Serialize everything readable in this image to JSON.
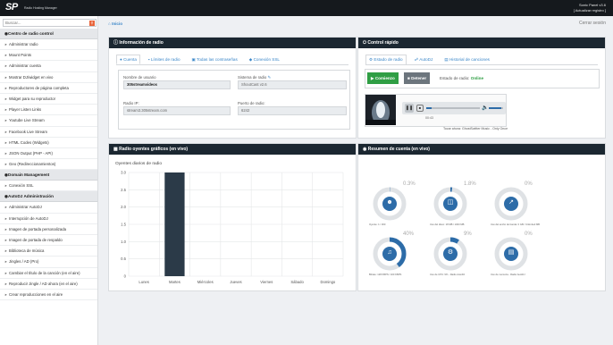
{
  "topbar": {
    "logo": "SP",
    "logo_sub": "Radio Hosting Manager",
    "right_line1": "Sonic Panel v3.6",
    "right_line2": "[ Actualizar registro ]"
  },
  "sidebar": {
    "search_placeholder": "Buscar...",
    "sections": [
      {
        "title": "Centro de radio control",
        "items": [
          "Administrar radio",
          "Mount Points",
          "Administrar cuenta",
          "Mostrar DJ/widget en vivo",
          "Reproductores de página completa",
          "Widget para su reproductor",
          "Player Listen Links",
          "Youtube Live Stream",
          "Facebook Live Stream",
          "HTML Codes (Widgets)",
          "JSON Output (PHP - API)",
          "Geo (Redireccionamientos)"
        ]
      },
      {
        "title": "Domain Management",
        "items": [
          "Conexión SSL"
        ]
      },
      {
        "title": "AutoDJ Administración",
        "items": [
          "Administrar AutoDJ",
          "Interrupción de AutoDJ",
          "Imagen de portada personalizada",
          "Imagen de portada de respaldo",
          "Biblioteca de música",
          "Jingles / AD (Pro)",
          "Cambiar el título de la canción (en el aire)",
          "Reproducir Jingle / AD ahora (en el aire)",
          "Crear reproducciones en el aire"
        ]
      }
    ]
  },
  "main": {
    "breadcrumb": "Inicio",
    "logout": "Cerrar sesión"
  },
  "radio_info": {
    "title": "Información de radio",
    "tabs": [
      "Cuenta",
      "Límites de radio",
      "Todas las contraseñas",
      "Conexión SSL"
    ],
    "fields": [
      {
        "label": "Nombre de usuario",
        "value": "305streamvideos"
      },
      {
        "label": "Sistema de radio",
        "value": "ShoutCast v2.6"
      },
      {
        "label": "Radio IP:",
        "value": "stream3.305stream.com"
      },
      {
        "label": "Puerto de radio:",
        "value": "6242"
      }
    ]
  },
  "quick_control": {
    "title": "Control rápido",
    "tabs": [
      "Estado de radio",
      "AutoDJ",
      "Historial de canciones"
    ],
    "start_label": "Comienzo",
    "stop_label": "Detener",
    "status_label": "Estado de radio:",
    "status_value": "Online",
    "time": "00:43",
    "now_playing": "Tocar ahora: GhostSwitter Music - Only Once",
    "progress": 0.1,
    "volume": 0.85
  },
  "listeners_chart": {
    "title": "Radio oyentes gráficos (en vivo)",
    "subtitle": "Oyentes diarios de radio"
  },
  "chart_data": {
    "type": "bar",
    "title": "Oyentes diarios de radio",
    "categories": [
      "Lunes",
      "Martes",
      "Miércoles",
      "Jueves",
      "Viernes",
      "Sábado",
      "Domingo"
    ],
    "values": [
      0,
      3,
      0,
      0,
      0,
      0,
      0
    ],
    "ylim": [
      0,
      3
    ],
    "yticks": [
      "3.0",
      "2.5",
      "2.0",
      "1.5",
      "1.0",
      "0.5",
      "0"
    ],
    "bar_color": "#2b3a48",
    "grid": true
  },
  "account_summary": {
    "title": "Resumen de cuenta (en vivo)",
    "gauges": [
      {
        "pct": "0.3%",
        "value": 0.003,
        "label": "Oyente: 1 / 300",
        "icon": "users-icon"
      },
      {
        "pct": "1.8%",
        "value": 0.018,
        "label": "Uso del disco: 18 MB / 1000 MB",
        "icon": "disk-icon"
      },
      {
        "pct": "0%",
        "value": 0,
        "label": "Uso del ancho de banda: 0 GB / Unlimited MB",
        "icon": "chart-icon"
      },
      {
        "pct": "40%",
        "value": 0.4,
        "label": "Bitrate: 128 KBPS / 320 KBPS",
        "icon": "volume-icon"
      },
      {
        "pct": "9%",
        "value": 0.09,
        "label": "Uso de CPU: 9% - Radio AutoDJ",
        "icon": "cpu-icon"
      },
      {
        "pct": "0%",
        "value": 0,
        "label": "Uso de memoria - Radio AutoDJ",
        "icon": "memory-icon"
      }
    ]
  },
  "colors": {
    "accent": "#3a86c8",
    "header": "#1b2731",
    "start": "#2f9e44",
    "stop": "#6c757d",
    "online": "#2f9e44",
    "gauge": "#2d6ca8"
  }
}
